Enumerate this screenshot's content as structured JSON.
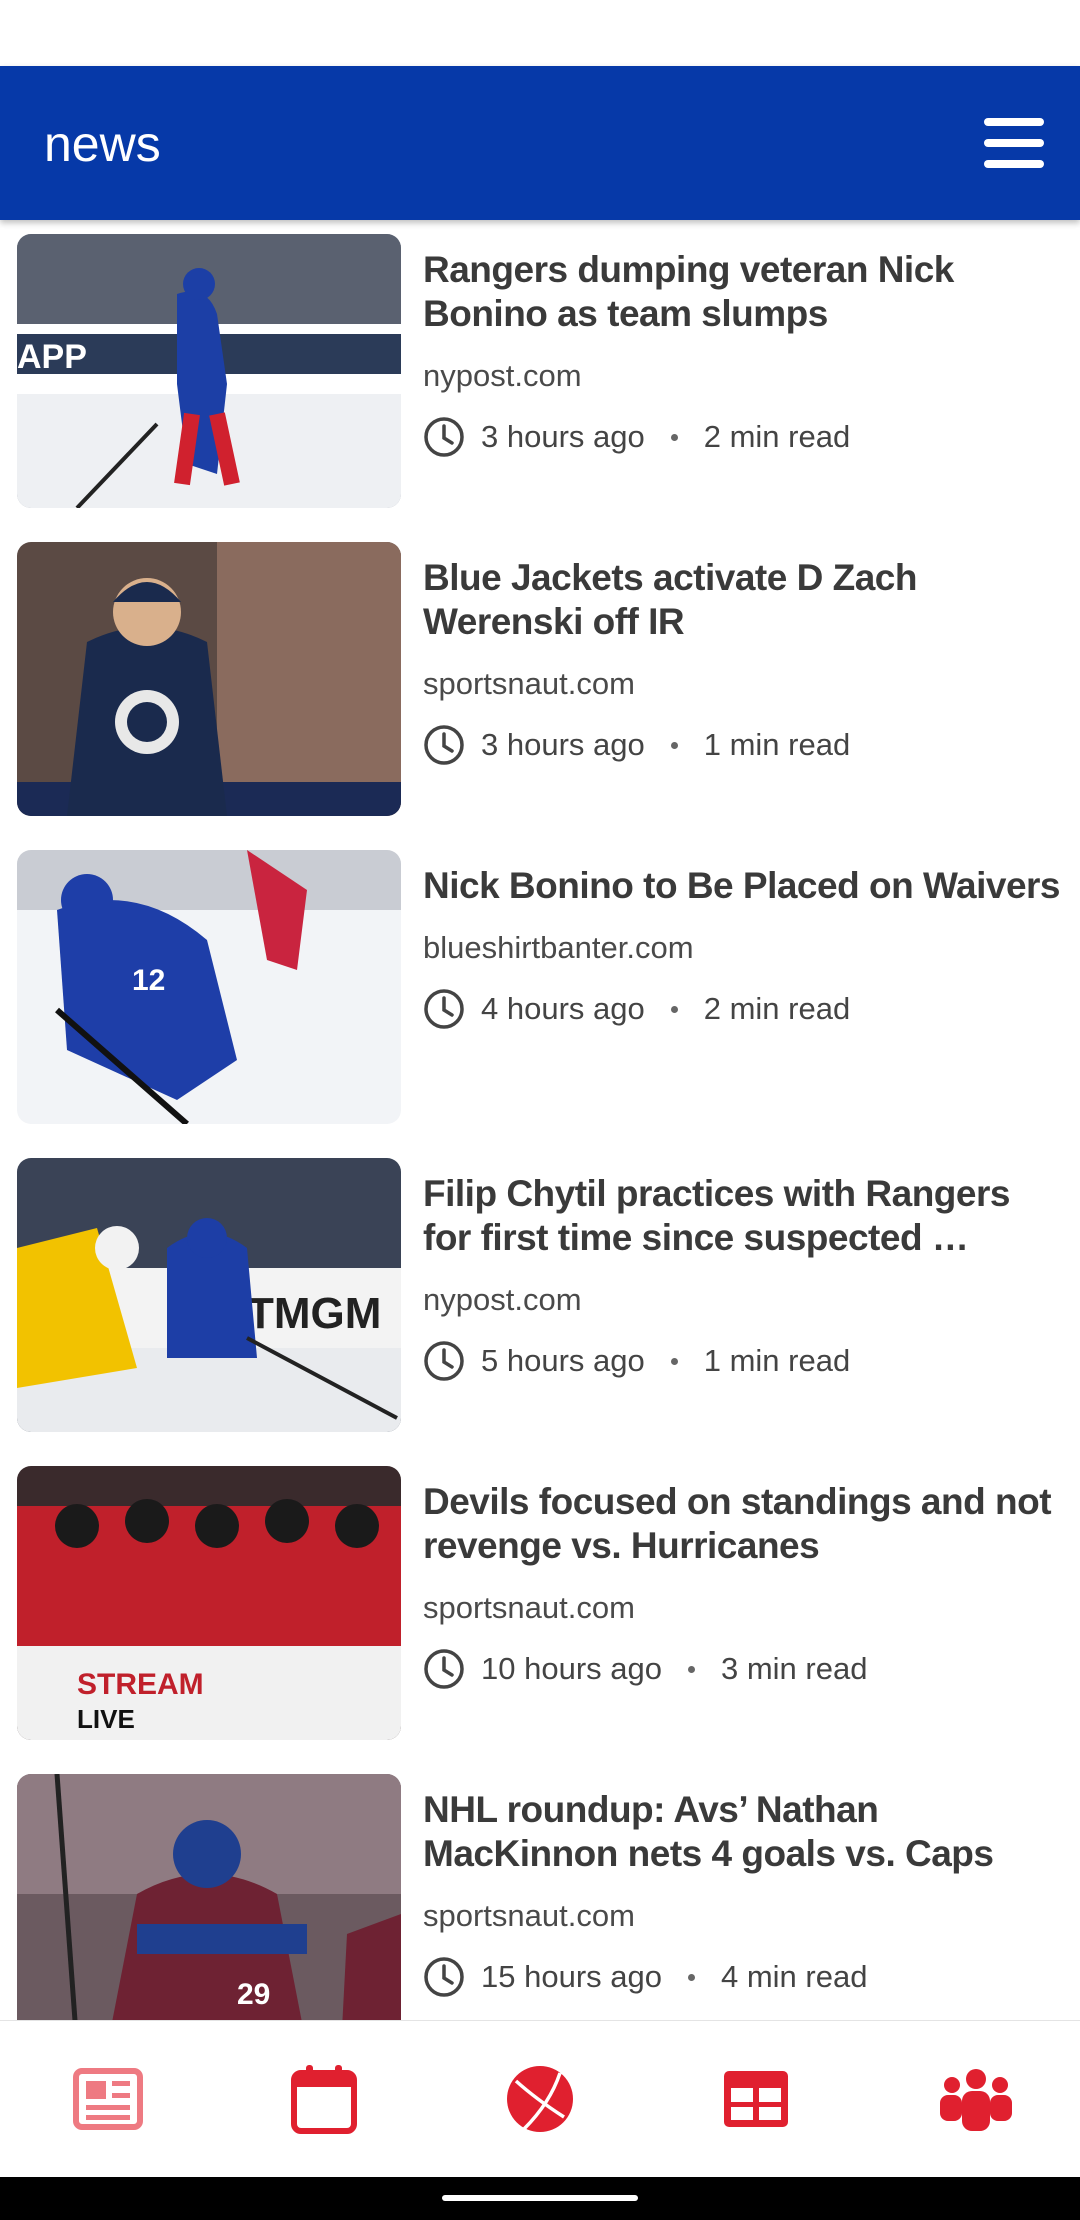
{
  "app": {
    "title": "news"
  },
  "articles": [
    {
      "headline": "Rangers dumping veteran Nick Bonino as team slumps",
      "source": "nypost.com",
      "time": "3 hours ago",
      "read": "2 min read"
    },
    {
      "headline": "Blue Jackets activate D Zach Werenski off IR",
      "source": "sportsnaut.com",
      "time": "3 hours ago",
      "read": "1 min read"
    },
    {
      "headline": "Nick Bonino to Be Placed on Waivers",
      "source": "blueshirtbanter.com",
      "time": "4 hours ago",
      "read": "2 min read"
    },
    {
      "headline": "Filip Chytil practices with Rangers for first time since suspected …",
      "source": "nypost.com",
      "time": "5 hours ago",
      "read": "1 min read"
    },
    {
      "headline": "Devils focused on standings and not revenge vs. Hurricanes",
      "source": "sportsnaut.com",
      "time": "10 hours ago",
      "read": "3 min read"
    },
    {
      "headline": "NHL roundup: Avs’ Nathan MacKinnon nets 4 goals vs. Caps",
      "source": "sportsnaut.com",
      "time": "15 hours ago",
      "read": "4 min read"
    }
  ],
  "bottom_nav": [
    {
      "icon": "newspaper-icon",
      "active": true
    },
    {
      "icon": "calendar-icon"
    },
    {
      "icon": "ball-icon"
    },
    {
      "icon": "standings-grid-icon"
    },
    {
      "icon": "team-people-icon"
    }
  ],
  "colors": {
    "app_bar": "#0639a8",
    "nav_red": "#e0202f",
    "nav_active": "#ee7a82"
  }
}
